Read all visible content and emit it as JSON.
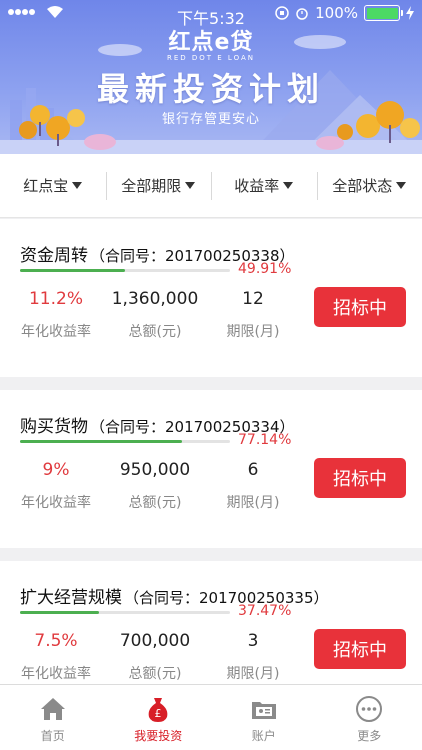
{
  "status_bar": {
    "time": "下午5:32",
    "battery_pct": "100%"
  },
  "header": {
    "logo_text": "红点e贷",
    "logo_sub": "RED DOT E LOAN",
    "title": "最新投资计划",
    "subtitle": "银行存管更安心"
  },
  "filters": [
    {
      "label": "红点宝"
    },
    {
      "label": "全部期限"
    },
    {
      "label": "收益率"
    },
    {
      "label": "全部状态"
    }
  ],
  "loans": [
    {
      "name": "资金周转",
      "contract": "（合同号：201700250338）",
      "progress_pct": "49.91%",
      "progress": 0.4991,
      "rate": "11.2%",
      "rate_label": "年化收益率",
      "amount": "1,360,000",
      "amount_label": "总额(元)",
      "term": "12",
      "term_label": "期限(月)",
      "button": "招标中"
    },
    {
      "name": "购买货物",
      "contract": "（合同号：201700250334）",
      "progress_pct": "77.14%",
      "progress": 0.7714,
      "rate": "9%",
      "rate_label": "年化收益率",
      "amount": "950,000",
      "amount_label": "总额(元)",
      "term": "6",
      "term_label": "期限(月)",
      "button": "招标中"
    },
    {
      "name": "扩大经营规模",
      "contract": "（合同号：201700250335）",
      "progress_pct": "37.47%",
      "progress": 0.3747,
      "rate": "7.5%",
      "rate_label": "年化收益率",
      "amount": "700,000",
      "amount_label": "总额(元)",
      "term": "3",
      "term_label": "期限(月)",
      "button": "招标中"
    }
  ],
  "tabs": [
    {
      "label": "首页",
      "icon": "home-icon",
      "active": false
    },
    {
      "label": "我要投资",
      "icon": "money-bag-icon",
      "active": true
    },
    {
      "label": "账户",
      "icon": "account-folder-icon",
      "active": false
    },
    {
      "label": "更多",
      "icon": "more-icon",
      "active": false
    }
  ],
  "colors": {
    "accent": "#e8323a",
    "progress": "#4caf50",
    "banner": "#7a8fec",
    "active_tab": "#d81e27"
  }
}
